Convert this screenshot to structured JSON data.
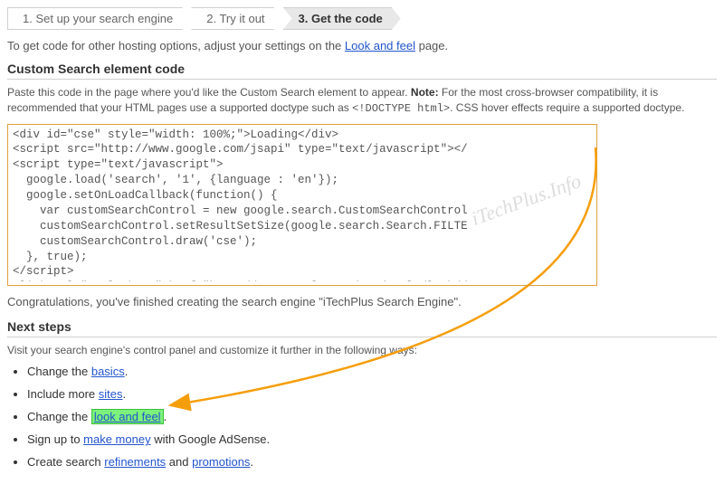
{
  "steps": {
    "s1": "1. Set up your search engine",
    "s2": "2. Try it out",
    "s3": "3. Get the code"
  },
  "intro": {
    "text_a": "To get code for other hosting options, adjust your settings on the ",
    "link": "Look and feel",
    "text_b": " page."
  },
  "section1_title": "Custom Search element code",
  "note": {
    "pre": "Paste this code in the page where you'd like the Custom Search element to appear. ",
    "bold": "Note:",
    "post1": " For the most cross-browser compatibility, it is recommended that your HTML pages use a supported doctype such as ",
    "doctype": "<!DOCTYPE html>",
    "post2": ". CSS hover effects require a supported doctype."
  },
  "code": "<div id=\"cse\" style=\"width: 100%;\">Loading</div>\n<script src=\"http://www.google.com/jsapi\" type=\"text/javascript\"></\n<script type=\"text/javascript\">\n  google.load('search', '1', {language : 'en'});\n  google.setOnLoadCallback(function() {\n    var customSearchControl = new google.search.CustomSearchControl\n    customSearchControl.setResultSetSize(google.search.Search.FILTE\n    customSearchControl.draw('cse');\n  }, true);\n</script>\n<link rel=\"stylesheet\" href=\"http://www.google.com/cse/style/look/d",
  "congrats": "Congratulations, you've finished creating the search engine \"iTechPlus Search Engine\".",
  "section2_title": "Next steps",
  "next_intro": "Visit your search engine's control panel and customize it further in the following ways:",
  "list": {
    "i1a": "Change the ",
    "i1link": "basics",
    "i2a": "Include more ",
    "i2link": "sites",
    "i3a": "Change the ",
    "i3link": "look and feel",
    "i4a": "Sign up to ",
    "i4link": "make money",
    "i4b": " with Google AdSense.",
    "i5a": "Create search ",
    "i5link1": "refinements",
    "i5mid": " and ",
    "i5link2": "promotions"
  },
  "watermark": "iTechPlus.Info"
}
